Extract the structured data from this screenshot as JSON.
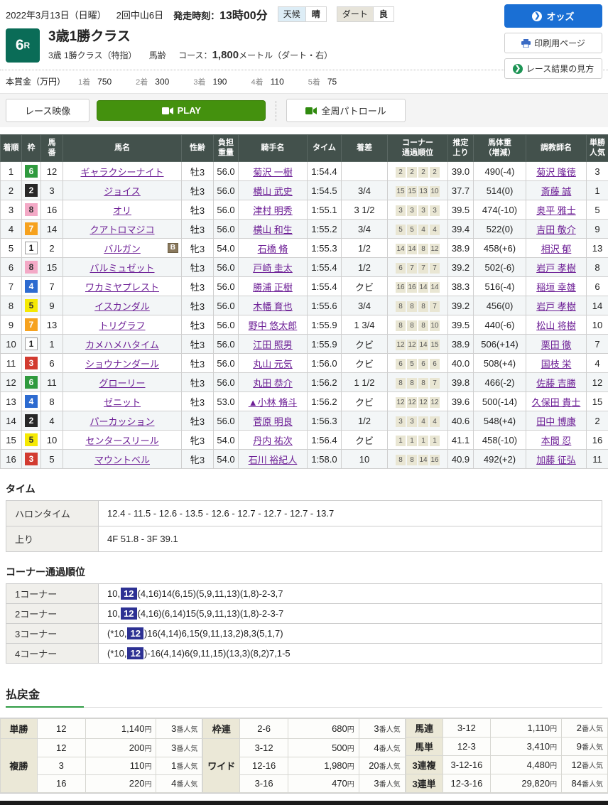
{
  "header": {
    "date": "2022年3月13日（日曜）",
    "meeting": "2回中山6日",
    "start_label": "発走時刻：",
    "start_time": "13時00分",
    "weather_label": "天候",
    "weather_value": "晴",
    "track_label": "ダート",
    "track_value": "良"
  },
  "side_buttons": {
    "odds": "オッズ",
    "print": "印刷用ページ",
    "guide": "レース結果の見方"
  },
  "race": {
    "number": "6",
    "number_suffix": "R",
    "title": "3歳1勝クラス",
    "conditions": "3歳 1勝クラス（特指）",
    "age_rule": "馬齢",
    "course_label": "コース：",
    "course_value": "1,800",
    "course_unit": "メートル（ダート・右）"
  },
  "prize": {
    "label": "本賞金（万円）",
    "items": [
      {
        "place": "1着",
        "amount": "750"
      },
      {
        "place": "2着",
        "amount": "300"
      },
      {
        "place": "3着",
        "amount": "190"
      },
      {
        "place": "4着",
        "amount": "110"
      },
      {
        "place": "5着",
        "amount": "75"
      }
    ]
  },
  "toolbar": {
    "race_video": "レース映像",
    "play": "PLAY",
    "patrol": "全周パトロール"
  },
  "results": {
    "headers": [
      "着順",
      "枠",
      "馬\n番",
      "馬名",
      "性齢",
      "負担\n重量",
      "騎手名",
      "タイム",
      "着差",
      "コーナー\n通過順位",
      "推定\n上り",
      "馬体重\n（増減）",
      "調教師名",
      "単勝\n人気"
    ],
    "rows": [
      {
        "finish": "1",
        "waku": "6",
        "num": "12",
        "horse": "ギャラクシーナイト",
        "blinker": false,
        "sexage": "牡3",
        "weight": "56.0",
        "jockey": "菊沢 一樹",
        "time": "1:54.4",
        "margin": "",
        "corners": [
          "2",
          "2",
          "2",
          "2"
        ],
        "last3f": "39.0",
        "body": "490(-4)",
        "trainer": "菊沢 隆徳",
        "pop": "3"
      },
      {
        "finish": "2",
        "waku": "2",
        "num": "3",
        "horse": "ジョイス",
        "blinker": false,
        "sexage": "牡3",
        "weight": "56.0",
        "jockey": "横山 武史",
        "time": "1:54.5",
        "margin": "3/4",
        "corners": [
          "15",
          "15",
          "13",
          "10"
        ],
        "last3f": "37.7",
        "body": "514(0)",
        "trainer": "斎藤 誠",
        "pop": "1"
      },
      {
        "finish": "3",
        "waku": "8",
        "num": "16",
        "horse": "オリ",
        "blinker": false,
        "sexage": "牡3",
        "weight": "56.0",
        "jockey": "津村 明秀",
        "time": "1:55.1",
        "margin": "3 1/2",
        "corners": [
          "3",
          "3",
          "3",
          "3"
        ],
        "last3f": "39.5",
        "body": "474(-10)",
        "trainer": "奥平 雅士",
        "pop": "5"
      },
      {
        "finish": "4",
        "waku": "7",
        "num": "14",
        "horse": "クアトロマジコ",
        "blinker": false,
        "sexage": "牡3",
        "weight": "56.0",
        "jockey": "横山 和生",
        "time": "1:55.2",
        "margin": "3/4",
        "corners": [
          "5",
          "5",
          "4",
          "4"
        ],
        "last3f": "39.4",
        "body": "522(0)",
        "trainer": "吉田 敬介",
        "pop": "9"
      },
      {
        "finish": "5",
        "waku": "1",
        "num": "2",
        "horse": "バルガン",
        "blinker": true,
        "sexage": "牝3",
        "weight": "54.0",
        "jockey": "石橋 脩",
        "time": "1:55.3",
        "margin": "1/2",
        "corners": [
          "14",
          "14",
          "8",
          "12"
        ],
        "last3f": "38.9",
        "body": "458(+6)",
        "trainer": "相沢 郁",
        "pop": "13"
      },
      {
        "finish": "6",
        "waku": "8",
        "num": "15",
        "horse": "バルミュゼット",
        "blinker": false,
        "sexage": "牡3",
        "weight": "56.0",
        "jockey": "戸崎 圭太",
        "time": "1:55.4",
        "margin": "1/2",
        "corners": [
          "6",
          "7",
          "7",
          "7"
        ],
        "last3f": "39.2",
        "body": "502(-6)",
        "trainer": "岩戸 孝樹",
        "pop": "8"
      },
      {
        "finish": "7",
        "waku": "4",
        "num": "7",
        "horse": "ワカミヤプレスト",
        "blinker": false,
        "sexage": "牡3",
        "weight": "56.0",
        "jockey": "勝浦 正樹",
        "time": "1:55.4",
        "margin": "クビ",
        "corners": [
          "16",
          "16",
          "14",
          "14"
        ],
        "last3f": "38.3",
        "body": "516(-4)",
        "trainer": "稲垣 幸雄",
        "pop": "6"
      },
      {
        "finish": "8",
        "waku": "5",
        "num": "9",
        "horse": "イスカンダル",
        "blinker": false,
        "sexage": "牡3",
        "weight": "56.0",
        "jockey": "木幡 育也",
        "time": "1:55.6",
        "margin": "3/4",
        "corners": [
          "8",
          "8",
          "8",
          "7"
        ],
        "last3f": "39.2",
        "body": "456(0)",
        "trainer": "岩戸 孝樹",
        "pop": "14"
      },
      {
        "finish": "9",
        "waku": "7",
        "num": "13",
        "horse": "トリグラフ",
        "blinker": false,
        "sexage": "牡3",
        "weight": "56.0",
        "jockey": "野中 悠太郎",
        "time": "1:55.9",
        "margin": "1 3/4",
        "corners": [
          "8",
          "8",
          "8",
          "10"
        ],
        "last3f": "39.5",
        "body": "440(-6)",
        "trainer": "松山 将樹",
        "pop": "10"
      },
      {
        "finish": "10",
        "waku": "1",
        "num": "1",
        "horse": "カメハメハタイム",
        "blinker": false,
        "sexage": "牡3",
        "weight": "56.0",
        "jockey": "江田 照男",
        "time": "1:55.9",
        "margin": "クビ",
        "corners": [
          "12",
          "12",
          "14",
          "15"
        ],
        "last3f": "38.9",
        "body": "506(+14)",
        "trainer": "栗田 徹",
        "pop": "7"
      },
      {
        "finish": "11",
        "waku": "3",
        "num": "6",
        "horse": "ショウナンダール",
        "blinker": false,
        "sexage": "牡3",
        "weight": "56.0",
        "jockey": "丸山 元気",
        "time": "1:56.0",
        "margin": "クビ",
        "corners": [
          "6",
          "5",
          "6",
          "6"
        ],
        "last3f": "40.0",
        "body": "508(+4)",
        "trainer": "国枝 栄",
        "pop": "4"
      },
      {
        "finish": "12",
        "waku": "6",
        "num": "11",
        "horse": "グローリー",
        "blinker": false,
        "sexage": "牡3",
        "weight": "56.0",
        "jockey": "丸田 恭介",
        "time": "1:56.2",
        "margin": "1 1/2",
        "corners": [
          "8",
          "8",
          "8",
          "7"
        ],
        "last3f": "39.8",
        "body": "466(-2)",
        "trainer": "佐藤 吉勝",
        "pop": "12"
      },
      {
        "finish": "13",
        "waku": "4",
        "num": "8",
        "horse": "ゼニット",
        "blinker": false,
        "sexage": "牡3",
        "weight": "53.0",
        "jockey": "▲小林 脩斗",
        "time": "1:56.2",
        "margin": "クビ",
        "corners": [
          "12",
          "12",
          "12",
          "12"
        ],
        "last3f": "39.6",
        "body": "500(-14)",
        "trainer": "久保田 貴士",
        "pop": "15"
      },
      {
        "finish": "14",
        "waku": "2",
        "num": "4",
        "horse": "パーカッション",
        "blinker": false,
        "sexage": "牡3",
        "weight": "56.0",
        "jockey": "菅原 明良",
        "time": "1:56.3",
        "margin": "1/2",
        "corners": [
          "3",
          "3",
          "4",
          "4"
        ],
        "last3f": "40.6",
        "body": "548(+4)",
        "trainer": "田中 博康",
        "pop": "2"
      },
      {
        "finish": "15",
        "waku": "5",
        "num": "10",
        "horse": "センタースリール",
        "blinker": false,
        "sexage": "牝3",
        "weight": "54.0",
        "jockey": "丹内 祐次",
        "time": "1:56.4",
        "margin": "クビ",
        "corners": [
          "1",
          "1",
          "1",
          "1"
        ],
        "last3f": "41.1",
        "body": "458(-10)",
        "trainer": "本間 忍",
        "pop": "16"
      },
      {
        "finish": "16",
        "waku": "3",
        "num": "5",
        "horse": "マウントベル",
        "blinker": false,
        "sexage": "牝3",
        "weight": "54.0",
        "jockey": "石川 裕紀人",
        "time": "1:58.0",
        "margin": "10",
        "corners": [
          "8",
          "8",
          "14",
          "16"
        ],
        "last3f": "40.9",
        "body": "492(+2)",
        "trainer": "加藤 征弘",
        "pop": "11"
      }
    ]
  },
  "time_section": {
    "title": "タイム",
    "rows": [
      {
        "label": "ハロンタイム",
        "value": "12.4 - 11.5 - 12.6 - 13.5 - 12.6 - 12.7 - 12.7 - 12.7 - 13.7"
      },
      {
        "label": "上り",
        "value": "4F 51.8 - 3F 39.1"
      }
    ]
  },
  "corner_section": {
    "title": "コーナー通過順位",
    "rows": [
      {
        "label": "1コーナー",
        "pre": "10,",
        "hl": "12",
        "post": "(4,16)14(6,15)(5,9,11,13)(1,8)-2-3,7"
      },
      {
        "label": "2コーナー",
        "pre": "10,",
        "hl": "12",
        "post": "(4,16)(6,14)15(5,9,11,13)(1,8)-2-3-7"
      },
      {
        "label": "3コーナー",
        "pre": "(*10,",
        "hl": "12",
        "post": ")16(4,14)6,15(9,11,13,2)8,3(5,1,7)"
      },
      {
        "label": "4コーナー",
        "pre": "(*10,",
        "hl": "12",
        "post": ")-16(4,14)6(9,11,15)(13,3)(8,2)7,1-5"
      }
    ]
  },
  "payout": {
    "title": "払戻金",
    "yen": "円",
    "pop_suffix": "番人気",
    "groups": [
      {
        "rows": [
          {
            "label": "単勝",
            "span": 1,
            "combo": "12",
            "amount": "1,140",
            "pop": "3"
          },
          {
            "label": "複勝",
            "span": 3,
            "combo": "12",
            "amount": "200",
            "pop": "3"
          },
          {
            "combo": "3",
            "amount": "110",
            "pop": "1"
          },
          {
            "combo": "16",
            "amount": "220",
            "pop": "4"
          }
        ]
      },
      {
        "rows": [
          {
            "label": "枠連",
            "span": 1,
            "combo": "2-6",
            "amount": "680",
            "pop": "3"
          },
          {
            "label": "ワイド",
            "span": 3,
            "combo": "3-12",
            "amount": "500",
            "pop": "4"
          },
          {
            "combo": "12-16",
            "amount": "1,980",
            "pop": "20"
          },
          {
            "combo": "3-16",
            "amount": "470",
            "pop": "3"
          }
        ]
      },
      {
        "rows": [
          {
            "label": "馬連",
            "span": 1,
            "combo": "3-12",
            "amount": "1,110",
            "pop": "2"
          },
          {
            "label": "馬単",
            "span": 1,
            "combo": "12-3",
            "amount": "3,410",
            "pop": "9"
          },
          {
            "label": "3連複",
            "span": 1,
            "combo": "3-12-16",
            "amount": "4,480",
            "pop": "12"
          },
          {
            "label": "3連単",
            "span": 1,
            "combo": "12-3-16",
            "amount": "29,820",
            "pop": "84"
          }
        ]
      }
    ]
  },
  "colors": {
    "accent_green": "#0a6c57",
    "play_green": "#44910e",
    "odds_blue": "#1a6fd4",
    "link_purple": "#6d1f96",
    "table_header_bg": "#43514c",
    "corner_highlight_navy": "#2d3193",
    "payout_label_bg": "#ebe8d7"
  }
}
